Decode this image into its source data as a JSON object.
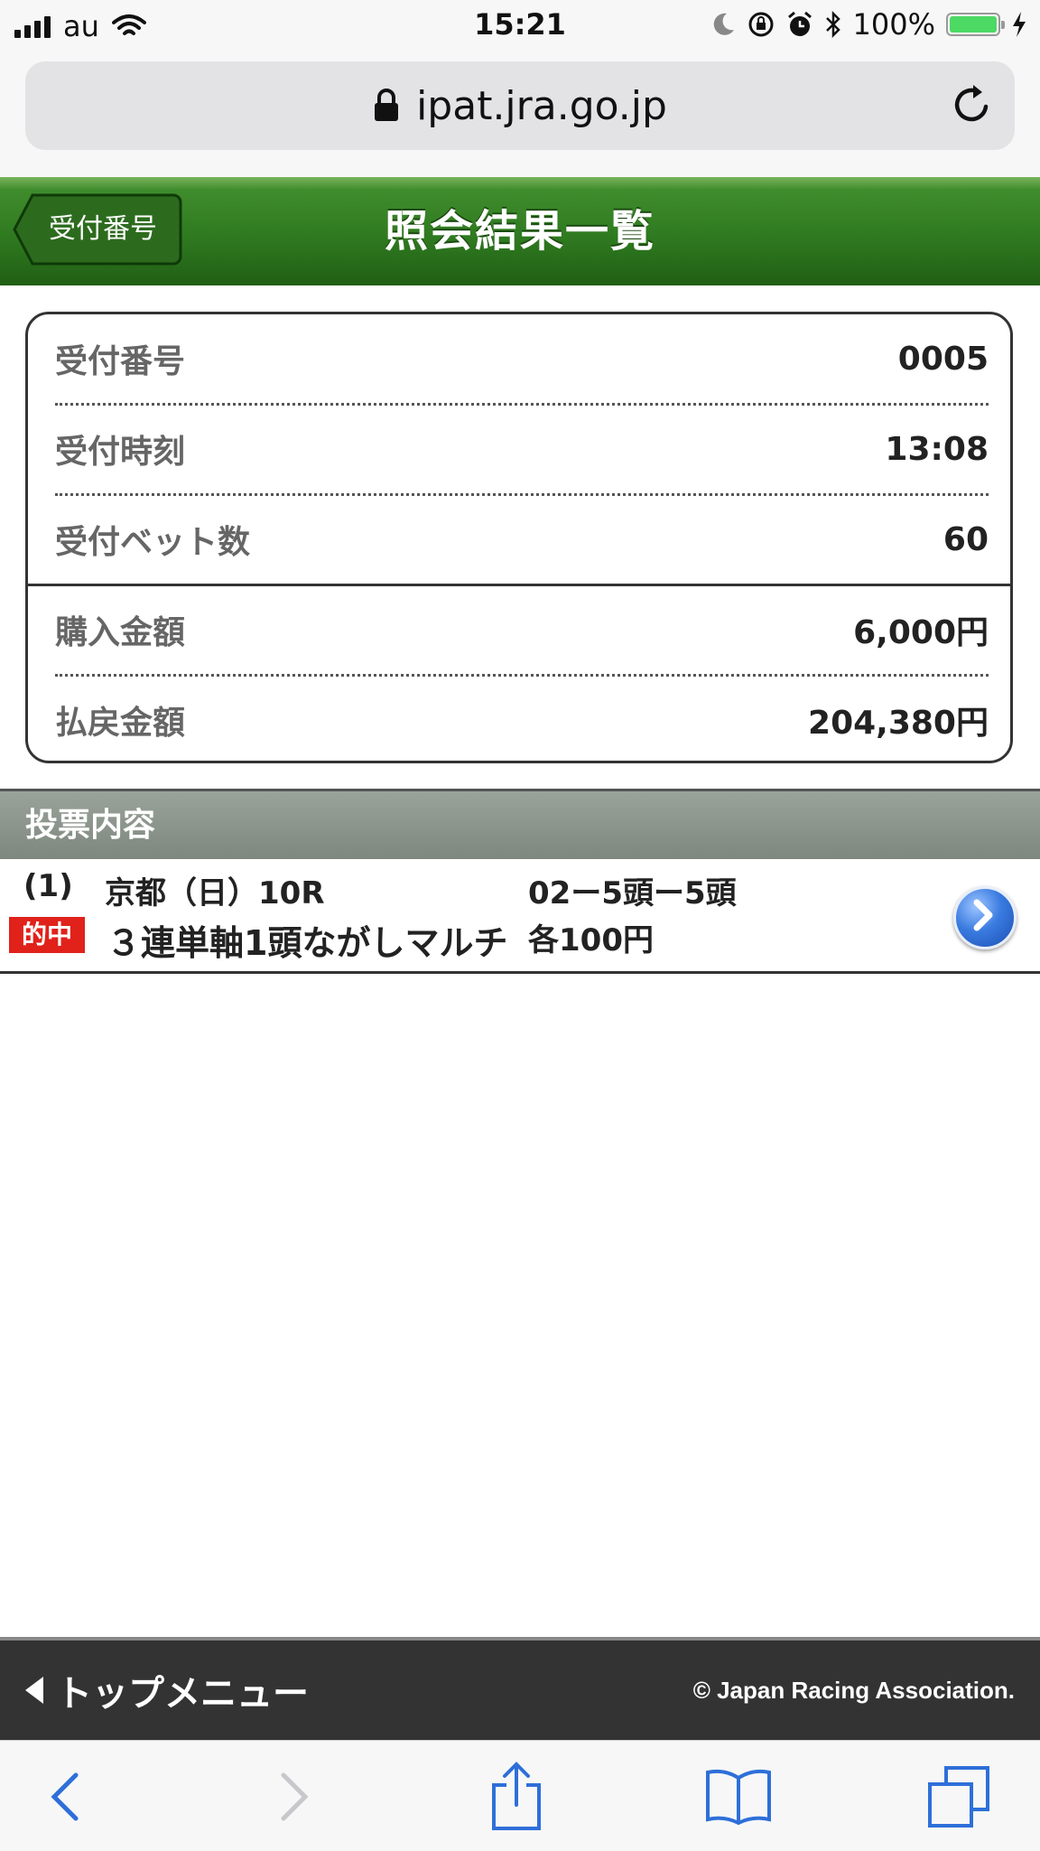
{
  "status_bar": {
    "carrier": "au",
    "time": "15:21",
    "battery": "100%",
    "battery_level": 1.0
  },
  "browser": {
    "url": "ipat.jra.go.jp"
  },
  "header": {
    "back_label": "受付番号",
    "title": "照会結果一覧"
  },
  "summary": {
    "rows": [
      {
        "label": "受付番号",
        "value": "0005"
      },
      {
        "label": "受付時刻",
        "value": "13:08"
      },
      {
        "label": "受付ベット数",
        "value": "60"
      },
      {
        "label": "購入金額",
        "value": "6,000円"
      },
      {
        "label": "払戻金額",
        "value": "204,380円"
      }
    ]
  },
  "section": {
    "title": "投票内容"
  },
  "bets": [
    {
      "index": "(1)",
      "venue": "京都（日）10R",
      "combination": "02ー5頭ー5頭",
      "status": "的中",
      "type": "３連単軸1頭ながしマルチ",
      "amount": "各100円"
    }
  ],
  "footer": {
    "top_menu": "トップメニュー",
    "copyright": "© Japan Racing Association."
  },
  "colors": {
    "header_green": "#2f7a20",
    "hit_red": "#e0221b",
    "arrow_blue": "#3a7be0"
  },
  "toolbar": {
    "icons": [
      "back-icon",
      "forward-icon",
      "share-icon",
      "bookmarks-icon",
      "tabs-icon"
    ]
  }
}
